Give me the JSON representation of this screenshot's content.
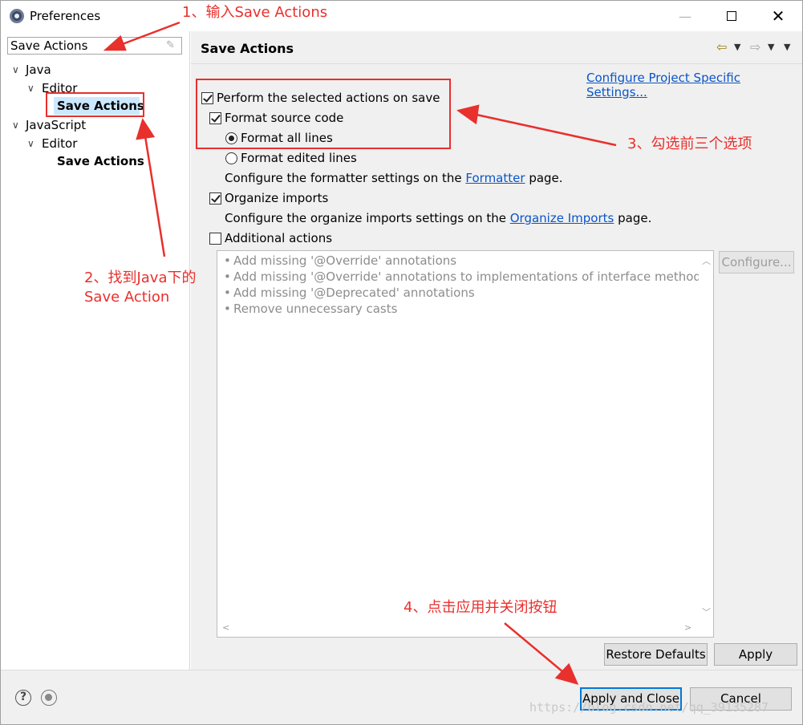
{
  "window": {
    "title": "Preferences",
    "minimize_symbol": "—",
    "close_symbol": "✕"
  },
  "filter": {
    "value": "Save Actions"
  },
  "tree": {
    "java": "Java",
    "java_editor": "Editor",
    "java_save_actions": "Save Actions",
    "javascript": "JavaScript",
    "javascript_editor": "Editor",
    "javascript_save_actions": "Save Actions"
  },
  "page": {
    "title": "Save Actions",
    "configure_project_link": "Configure Project Specific Settings...",
    "perform_on_save": "Perform the selected actions on save",
    "format_source": "Format source code",
    "format_all_lines": "Format all lines",
    "format_edited_lines": "Format edited lines",
    "formatter_text_before": "Configure the formatter settings on the",
    "formatter_link": "Formatter",
    "formatter_text_after": "page.",
    "organize_imports": "Organize imports",
    "organize_text_before": "Configure the organize imports settings on the",
    "organize_link": "Organize Imports",
    "organize_text_after": "page.",
    "additional_actions": "Additional actions",
    "additional_items": [
      "Add missing '@Override' annotations",
      "Add missing '@Override' annotations to implementations of interface methods",
      "Add missing '@Deprecated' annotations",
      "Remove unnecessary casts"
    ],
    "configure_button": "Configure...",
    "restore_defaults_button": "Restore Defaults",
    "apply_button": "Apply"
  },
  "footer": {
    "help_symbol": "?",
    "apply_close_button": "Apply and Close",
    "cancel_button": "Cancel"
  },
  "annotations": {
    "step1": "1、输入Save Actions",
    "step2_line1": "2、找到Java下的",
    "step2_line2": "Save Action",
    "step3": "3、勾选前三个选项",
    "step4": "4、点击应用并关闭按钮",
    "watermark": "https://blog.csdn.net/qq_39135287"
  },
  "colors": {
    "annotation_red": "#e8302d",
    "link_blue": "#0a55c7",
    "selection": "#cce8ff",
    "default_button_border": "#0078d7"
  }
}
